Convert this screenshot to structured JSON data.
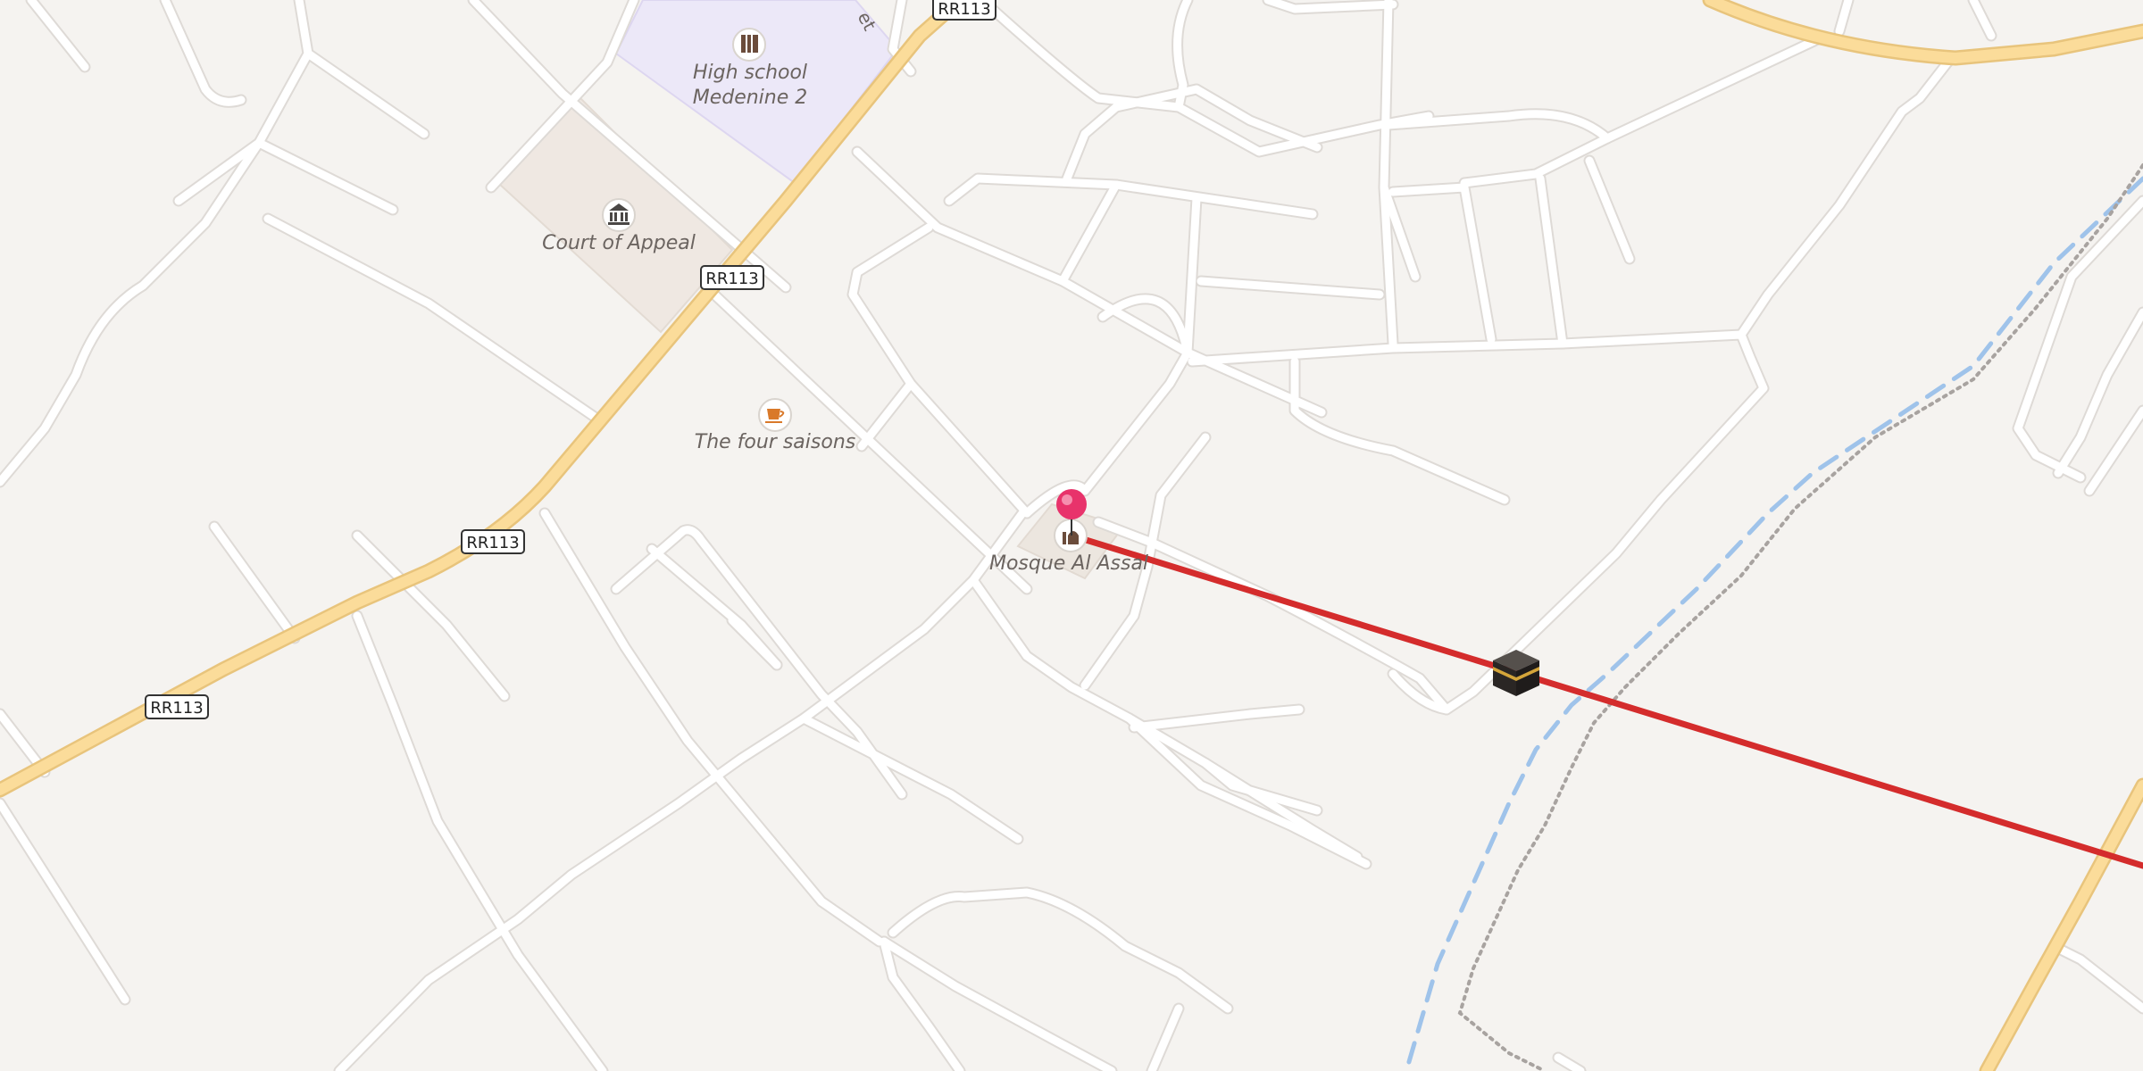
{
  "map": {
    "road_shields": [
      "RR113",
      "RR113",
      "RR113",
      "RR113"
    ],
    "street_label_fragment": "et",
    "pois": [
      {
        "name": "High school Medenine 2",
        "lines": [
          "High school",
          "Medenine 2"
        ],
        "icon": "school-icon"
      },
      {
        "name": "Court of Appeal",
        "icon": "courthouse-icon"
      },
      {
        "name": "The four saisons",
        "icon": "cafe-icon"
      },
      {
        "name": "Mosque Al Assal",
        "icon": "mosque-icon"
      }
    ],
    "markers": [
      {
        "kind": "location-pin",
        "color": "#e8336b"
      },
      {
        "kind": "kaaba-icon",
        "meaning": "qibla direction"
      }
    ],
    "colors": {
      "background": "#f5f3f0",
      "road": "#ffffff",
      "road_casing": "#dedad6",
      "primary_road": "#fbdc9a",
      "primary_road_casing": "#e8c47c",
      "school_area": "#ece8f8",
      "court_area": "#efe8e2",
      "qibla_line": "#d42c2c",
      "stream": "#9fc3ea",
      "boundary": "#a8a3a0"
    }
  }
}
